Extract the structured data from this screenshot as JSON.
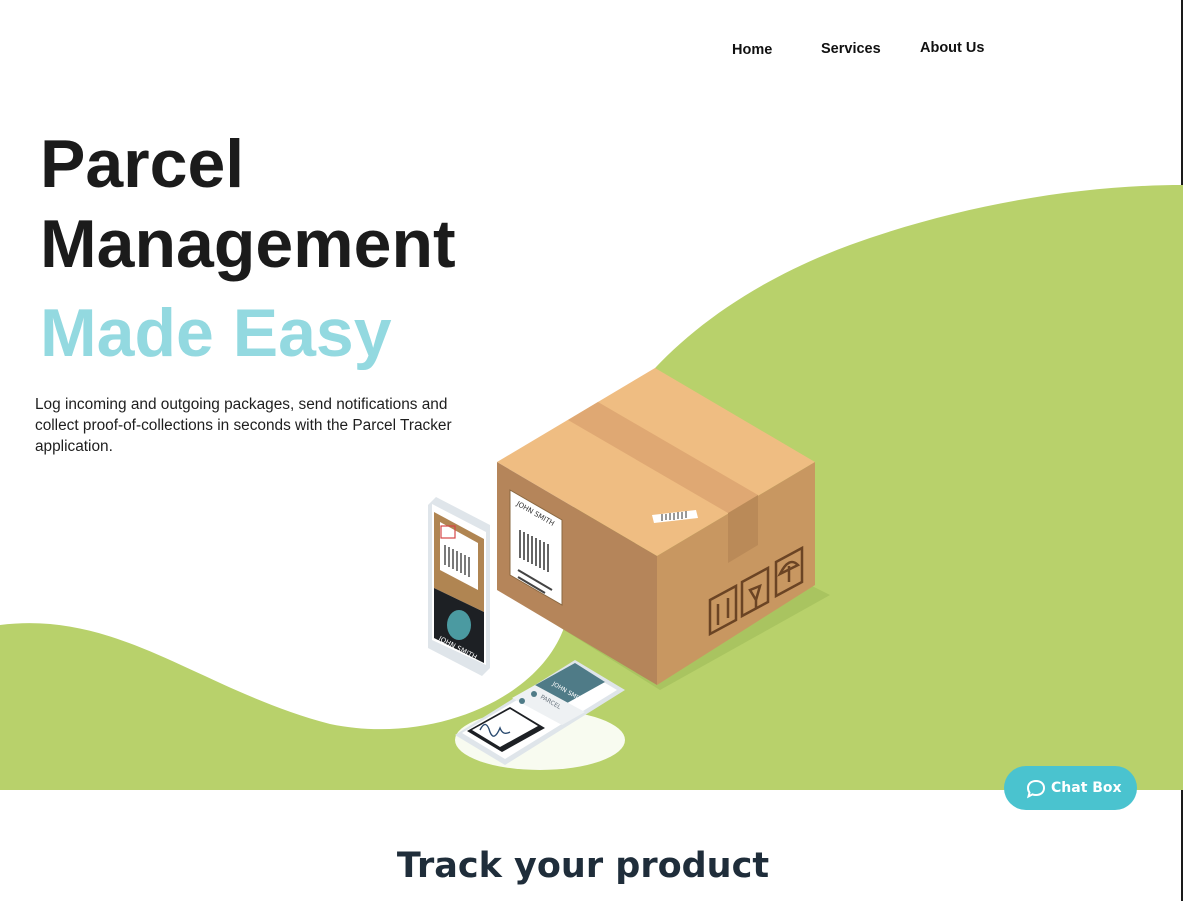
{
  "nav": {
    "items": [
      {
        "label": "Home"
      },
      {
        "label": "Services"
      },
      {
        "label": "About Us"
      }
    ]
  },
  "hero": {
    "title_line1": "Parcel",
    "title_line2": "Management",
    "title_accent": "Made Easy",
    "description": "Log incoming and outgoing packages, send notifications and collect proof-of-collections in seconds with the Parcel Tracker application.",
    "illustration": {
      "phone_label": "JOHN SMITH",
      "box_label_name": "JOHN SMITH",
      "tablet_rows": [
        "JOHN SMITH",
        "PARCEL"
      ]
    }
  },
  "chat": {
    "label": "Chat Box",
    "icon": "chat-bubble-icon"
  },
  "section": {
    "title": "Track your product"
  },
  "colors": {
    "hero_green": "#b8d16b",
    "accent_cyan": "#93d9e0",
    "chat_teal": "#4ac3cf",
    "box_tan": "#e6b074"
  }
}
